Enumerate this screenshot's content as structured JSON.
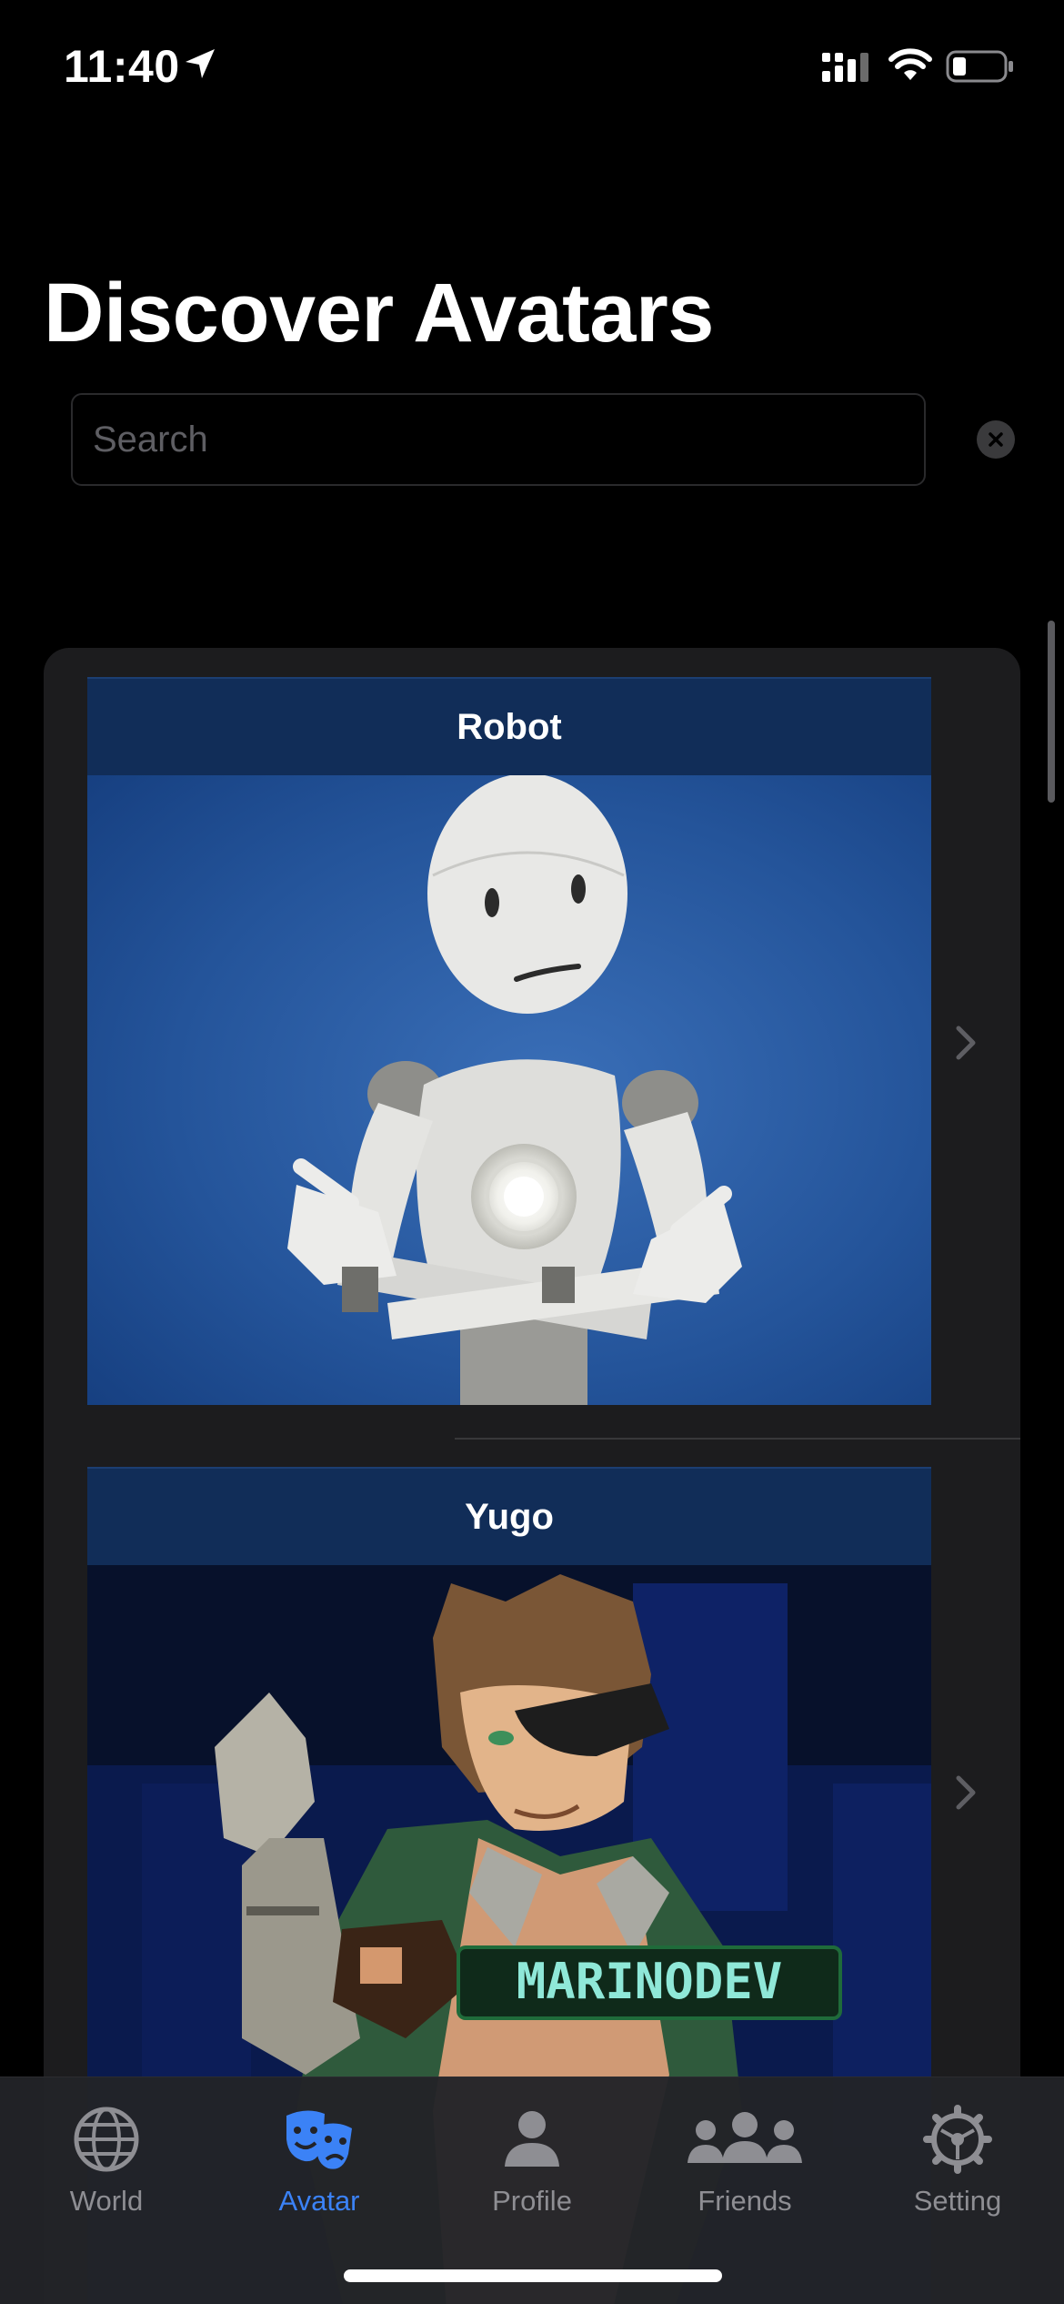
{
  "status_bar": {
    "time": "11:40",
    "icons": [
      "location-arrow-icon",
      "cellular-signal-icon",
      "wifi-icon",
      "battery-icon"
    ]
  },
  "page": {
    "title": "Discover Avatars"
  },
  "search": {
    "placeholder": "Search",
    "value": "",
    "clear_icon": "close-circle-icon"
  },
  "avatars": [
    {
      "name": "Robot",
      "chevron_icon": "chevron-right-icon"
    },
    {
      "name": "Yugo",
      "chevron_icon": "chevron-right-icon",
      "image_text": "MARINODEV"
    }
  ],
  "tab_bar": {
    "active_tab": "Avatar",
    "tabs": [
      {
        "label": "World",
        "icon": "globe-icon"
      },
      {
        "label": "Avatar",
        "icon": "masks-icon"
      },
      {
        "label": "Profile",
        "icon": "person-icon"
      },
      {
        "label": "Friends",
        "icon": "people-icon"
      },
      {
        "label": "Setting",
        "icon": "gear-icon"
      }
    ]
  },
  "colors": {
    "background": "#000000",
    "card_background": "#1c1c1e",
    "card_header": "#112d58",
    "accent": "#3b82f6",
    "inactive_tab": "#8e8e93"
  }
}
